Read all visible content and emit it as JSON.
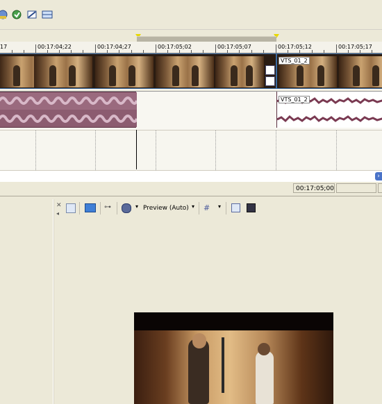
{
  "toolbar": {
    "icons": [
      "layer-add-icon",
      "refresh-green-icon",
      "snap-icon",
      "grid-layout-icon"
    ]
  },
  "ruler": {
    "labels": [
      "17",
      "00:17:04;22",
      "00:17:04;27",
      "00:17:05;02",
      "00:17:05;07",
      "00:17:05;12",
      "00:17:05;17"
    ]
  },
  "video_track": {
    "clip_label": "VTS_01_2"
  },
  "audio_track": {
    "clip_label": "VTS_01_2"
  },
  "status": {
    "cursor_timecode": "00:17:05;00",
    "second_field": ""
  },
  "preview": {
    "mode_label": "Preview (Auto)"
  },
  "colors": {
    "panel_bg": "#ece9d8",
    "clip_border": "#3b6aa0",
    "audio_wave": "#7a3a52",
    "loop_marker": "#e8d800"
  }
}
